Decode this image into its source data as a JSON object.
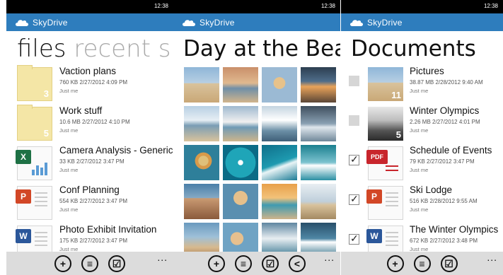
{
  "status_time": "12:38",
  "app_title": "SkyDrive",
  "screen1": {
    "pivot_active": "files",
    "pivot_rest": "recent sha",
    "items": [
      {
        "name": "Vaction plans",
        "meta": "760 KB  2/27/2012 4:09 PM",
        "owner": "Just me",
        "count": "3"
      },
      {
        "name": "Work stuff",
        "meta": "10.6 MB  2/27/2012 4:10 PM",
        "owner": "Just me",
        "count": "5"
      },
      {
        "name": "Camera Analysis - Generic",
        "meta": "33 KB  2/27/2012 3:47 PM",
        "owner": "Just me"
      },
      {
        "name": "Conf Planning",
        "meta": "554 KB  2/27/2012 3:47 PM",
        "owner": "Just me"
      },
      {
        "name": "Photo Exhibit Invitation",
        "meta": "175 KB  2/27/2012 3:47 PM",
        "owner": "Just me"
      }
    ]
  },
  "screen2": {
    "title": "Day at the Bea"
  },
  "screen3": {
    "title": "Documents",
    "items": [
      {
        "name": "Pictures",
        "meta": "38.87 MB  2/28/2012 9:40 AM",
        "owner": "Just me",
        "count": "11"
      },
      {
        "name": "Winter Olympics",
        "meta": "2.26 MB  2/27/2012 4:01 PM",
        "owner": "Just me",
        "count": "5"
      },
      {
        "name": "Schedule of Events",
        "meta": "79 KB  2/27/2012 3:47 PM",
        "owner": "Just me"
      },
      {
        "name": "Ski Lodge",
        "meta": "516 KB  2/28/2012 9:55 AM",
        "owner": "Just me"
      },
      {
        "name": "The Winter Olympics",
        "meta": "672 KB  2/27/2012 3:48 PM",
        "owner": "Just me"
      }
    ]
  },
  "icons": {
    "excel_badge": "X",
    "ppt_badge": "P",
    "word_badge": "W",
    "pdf_badge": "PDF"
  },
  "appbar_more": "...",
  "colors": {
    "accent": "#2e7dbd",
    "statusbar": "#000000",
    "appbar": "#dcdcdc"
  }
}
